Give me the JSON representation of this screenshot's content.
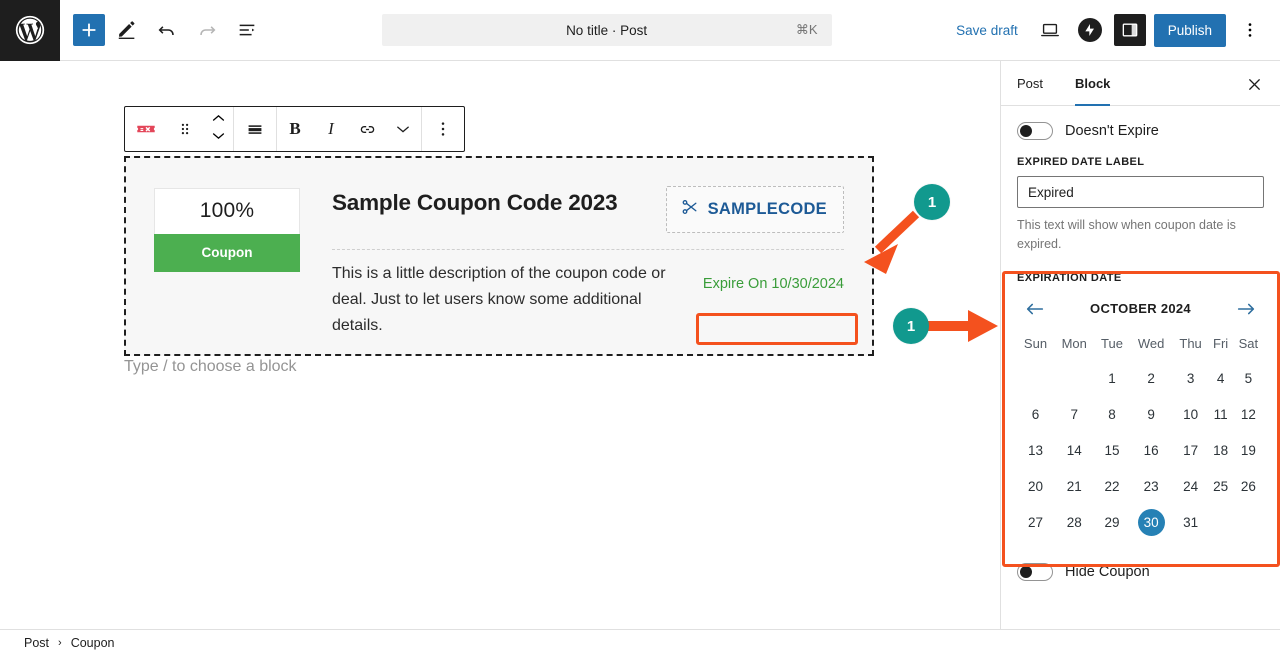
{
  "topbar": {
    "logo_icon": "wordpress-logo-icon",
    "add_block_icon": "plus-icon",
    "edit_icon": "pencil-icon",
    "undo_icon": "undo-arrow-icon",
    "redo_icon": "redo-arrow-icon",
    "list_view_icon": "document-outline-icon",
    "document_title": "No title · Post",
    "command_shortcut": "⌘K",
    "save_draft_label": "Save draft",
    "preview_icon": "laptop-preview-icon",
    "jetpack_icon": "jetpack-circle-icon",
    "settings_icon": "settings-sidebar-icon",
    "publish_label": "Publish",
    "options_icon": "vertical-ellipsis-icon"
  },
  "block_toolbar": {
    "block_type_icon": "coupon-ticket-icon",
    "drag_icon": "drag-handle-icon",
    "move_up_icon": "chevron-up-icon",
    "move_down_icon": "chevron-down-icon",
    "align_icon": "align-center-icon",
    "bold_label": "B",
    "italic_label": "I",
    "link_icon": "link-icon",
    "more_rich_text_icon": "chevron-down-icon",
    "options_icon": "vertical-ellipsis-icon"
  },
  "coupon": {
    "discount_value": "100%",
    "badge_label": "Coupon",
    "title": "Sample Coupon Code 2023",
    "code_icon": "scissors-icon",
    "code_text": "SAMPLECODE",
    "description": "This is a little description of the coupon code or deal. Just to let users know some additional details.",
    "expire_text": "Expire On 10/30/2024",
    "type_hint": "Type / to choose a block"
  },
  "sidebar": {
    "tabs": [
      {
        "label": "Post",
        "active": false
      },
      {
        "label": "Block",
        "active": true
      }
    ],
    "close_icon": "close-icon",
    "doesnt_expire": {
      "label": "Doesn't Expire",
      "state": "off"
    },
    "expired_date_label": {
      "field_label": "EXPIRED DATE LABEL",
      "value": "Expired",
      "placeholder": "Expired",
      "help_text": "This text will show when coupon date is expired."
    },
    "expiration_date": {
      "field_label": "EXPIRATION DATE",
      "month_year": "OCTOBER 2024",
      "prev_icon": "arrow-left-icon",
      "next_icon": "arrow-right-icon",
      "weekdays": [
        "Sun",
        "Mon",
        "Tue",
        "Wed",
        "Thu",
        "Fri",
        "Sat"
      ],
      "weeks": [
        [
          "",
          "",
          "1",
          "2",
          "3",
          "4",
          "5"
        ],
        [
          "6",
          "7",
          "8",
          "9",
          "10",
          "11",
          "12"
        ],
        [
          "13",
          "14",
          "15",
          "16",
          "17",
          "18",
          "19"
        ],
        [
          "20",
          "21",
          "22",
          "23",
          "24",
          "25",
          "26"
        ],
        [
          "27",
          "28",
          "29",
          "30",
          "31",
          "",
          ""
        ]
      ],
      "selected_day": "30"
    },
    "hide_coupon": {
      "label": "Hide Coupon",
      "state": "off"
    }
  },
  "footer": {
    "breadcrumb": [
      "Post",
      "Coupon"
    ],
    "separator": "›"
  },
  "annotations": [
    {
      "number": "1",
      "target": "expire-date-tag"
    },
    {
      "number": "1",
      "target": "expiration-date-calendar"
    }
  ],
  "colors": {
    "accent_blue": "#2271b1",
    "coupon_green": "#4caf50",
    "expire_green": "#3a9d3a",
    "code_blue": "#1d5a96",
    "annotation_orange": "#f4511e",
    "annotation_teal": "#11998e",
    "calendar_selected": "#2681b5"
  }
}
